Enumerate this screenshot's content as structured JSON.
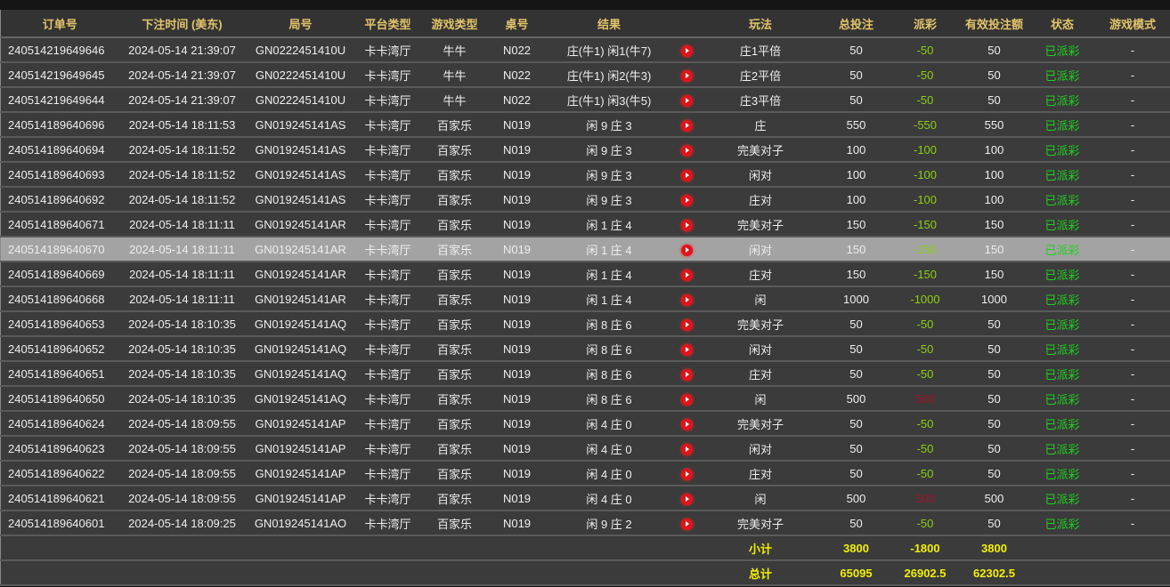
{
  "headers": [
    "订单号",
    "下注时间 (美东)",
    "局号",
    "平台类型",
    "游戏类型",
    "桌号",
    "结果",
    "",
    "玩法",
    "总投注",
    "派彩",
    "有效投注额",
    "状态",
    "游戏模式"
  ],
  "colors": {
    "header_text": "#e2c46a",
    "payout_negative": "#8ccf10",
    "payout_positive": "#a3122c",
    "status": "#1fd01f",
    "footer": "#f2f000",
    "highlight_row": "#a3a3a3"
  },
  "play_icon": "play-video-icon",
  "rows": [
    {
      "id": "240514219649646",
      "time": "2024-05-14 21:39:07",
      "round": "GN0222451410U",
      "platform": "卡卡湾厅",
      "game": "牛牛",
      "table": "N022",
      "result": "庄(牛1) 闲1(牛7)",
      "bet": "庄1平倍",
      "total": "50",
      "payout": "-50",
      "valid": "50",
      "status": "已派彩",
      "mode": "-"
    },
    {
      "id": "240514219649645",
      "time": "2024-05-14 21:39:07",
      "round": "GN0222451410U",
      "platform": "卡卡湾厅",
      "game": "牛牛",
      "table": "N022",
      "result": "庄(牛1) 闲2(牛3)",
      "bet": "庄2平倍",
      "total": "50",
      "payout": "-50",
      "valid": "50",
      "status": "已派彩",
      "mode": "-"
    },
    {
      "id": "240514219649644",
      "time": "2024-05-14 21:39:07",
      "round": "GN0222451410U",
      "platform": "卡卡湾厅",
      "game": "牛牛",
      "table": "N022",
      "result": "庄(牛1) 闲3(牛5)",
      "bet": "庄3平倍",
      "total": "50",
      "payout": "-50",
      "valid": "50",
      "status": "已派彩",
      "mode": "-"
    },
    {
      "id": "240514189640696",
      "time": "2024-05-14 18:11:53",
      "round": "GN019245141AS",
      "platform": "卡卡湾厅",
      "game": "百家乐",
      "table": "N019",
      "result": "闲 9 庄 3",
      "bet": "庄",
      "total": "550",
      "payout": "-550",
      "valid": "550",
      "status": "已派彩",
      "mode": "-"
    },
    {
      "id": "240514189640694",
      "time": "2024-05-14 18:11:52",
      "round": "GN019245141AS",
      "platform": "卡卡湾厅",
      "game": "百家乐",
      "table": "N019",
      "result": "闲 9 庄 3",
      "bet": "完美对子",
      "total": "100",
      "payout": "-100",
      "valid": "100",
      "status": "已派彩",
      "mode": "-"
    },
    {
      "id": "240514189640693",
      "time": "2024-05-14 18:11:52",
      "round": "GN019245141AS",
      "platform": "卡卡湾厅",
      "game": "百家乐",
      "table": "N019",
      "result": "闲 9 庄 3",
      "bet": "闲对",
      "total": "100",
      "payout": "-100",
      "valid": "100",
      "status": "已派彩",
      "mode": "-"
    },
    {
      "id": "240514189640692",
      "time": "2024-05-14 18:11:52",
      "round": "GN019245141AS",
      "platform": "卡卡湾厅",
      "game": "百家乐",
      "table": "N019",
      "result": "闲 9 庄 3",
      "bet": "庄对",
      "total": "100",
      "payout": "-100",
      "valid": "100",
      "status": "已派彩",
      "mode": "-"
    },
    {
      "id": "240514189640671",
      "time": "2024-05-14 18:11:11",
      "round": "GN019245141AR",
      "platform": "卡卡湾厅",
      "game": "百家乐",
      "table": "N019",
      "result": "闲 1 庄 4",
      "bet": "完美对子",
      "total": "150",
      "payout": "-150",
      "valid": "150",
      "status": "已派彩",
      "mode": "-"
    },
    {
      "id": "240514189640670",
      "time": "2024-05-14 18:11:11",
      "round": "GN019245141AR",
      "platform": "卡卡湾厅",
      "game": "百家乐",
      "table": "N019",
      "result": "闲 1 庄 4",
      "bet": "闲对",
      "total": "150",
      "payout": "-150",
      "valid": "150",
      "status": "已派彩",
      "mode": "-",
      "highlighted": true
    },
    {
      "id": "240514189640669",
      "time": "2024-05-14 18:11:11",
      "round": "GN019245141AR",
      "platform": "卡卡湾厅",
      "game": "百家乐",
      "table": "N019",
      "result": "闲 1 庄 4",
      "bet": "庄对",
      "total": "150",
      "payout": "-150",
      "valid": "150",
      "status": "已派彩",
      "mode": "-"
    },
    {
      "id": "240514189640668",
      "time": "2024-05-14 18:11:11",
      "round": "GN019245141AR",
      "platform": "卡卡湾厅",
      "game": "百家乐",
      "table": "N019",
      "result": "闲 1 庄 4",
      "bet": "闲",
      "total": "1000",
      "payout": "-1000",
      "valid": "1000",
      "status": "已派彩",
      "mode": "-"
    },
    {
      "id": "240514189640653",
      "time": "2024-05-14 18:10:35",
      "round": "GN019245141AQ",
      "platform": "卡卡湾厅",
      "game": "百家乐",
      "table": "N019",
      "result": "闲 8 庄 6",
      "bet": "完美对子",
      "total": "50",
      "payout": "-50",
      "valid": "50",
      "status": "已派彩",
      "mode": "-"
    },
    {
      "id": "240514189640652",
      "time": "2024-05-14 18:10:35",
      "round": "GN019245141AQ",
      "platform": "卡卡湾厅",
      "game": "百家乐",
      "table": "N019",
      "result": "闲 8 庄 6",
      "bet": "闲对",
      "total": "50",
      "payout": "-50",
      "valid": "50",
      "status": "已派彩",
      "mode": "-"
    },
    {
      "id": "240514189640651",
      "time": "2024-05-14 18:10:35",
      "round": "GN019245141AQ",
      "platform": "卡卡湾厅",
      "game": "百家乐",
      "table": "N019",
      "result": "闲 8 庄 6",
      "bet": "庄对",
      "total": "50",
      "payout": "-50",
      "valid": "50",
      "status": "已派彩",
      "mode": "-"
    },
    {
      "id": "240514189640650",
      "time": "2024-05-14 18:10:35",
      "round": "GN019245141AQ",
      "platform": "卡卡湾厅",
      "game": "百家乐",
      "table": "N019",
      "result": "闲 8 庄 6",
      "bet": "闲",
      "total": "500",
      "payout": "500",
      "valid": "50",
      "status": "已派彩",
      "mode": "-"
    },
    {
      "id": "240514189640624",
      "time": "2024-05-14 18:09:55",
      "round": "GN019245141AP",
      "platform": "卡卡湾厅",
      "game": "百家乐",
      "table": "N019",
      "result": "闲 4 庄 0",
      "bet": "完美对子",
      "total": "50",
      "payout": "-50",
      "valid": "50",
      "status": "已派彩",
      "mode": "-"
    },
    {
      "id": "240514189640623",
      "time": "2024-05-14 18:09:55",
      "round": "GN019245141AP",
      "platform": "卡卡湾厅",
      "game": "百家乐",
      "table": "N019",
      "result": "闲 4 庄 0",
      "bet": "闲对",
      "total": "50",
      "payout": "-50",
      "valid": "50",
      "status": "已派彩",
      "mode": "-"
    },
    {
      "id": "240514189640622",
      "time": "2024-05-14 18:09:55",
      "round": "GN019245141AP",
      "platform": "卡卡湾厅",
      "game": "百家乐",
      "table": "N019",
      "result": "闲 4 庄 0",
      "bet": "庄对",
      "total": "50",
      "payout": "-50",
      "valid": "50",
      "status": "已派彩",
      "mode": "-"
    },
    {
      "id": "240514189640621",
      "time": "2024-05-14 18:09:55",
      "round": "GN019245141AP",
      "platform": "卡卡湾厅",
      "game": "百家乐",
      "table": "N019",
      "result": "闲 4 庄 0",
      "bet": "闲",
      "total": "500",
      "payout": "500",
      "valid": "500",
      "status": "已派彩",
      "mode": "-"
    },
    {
      "id": "240514189640601",
      "time": "2024-05-14 18:09:25",
      "round": "GN019245141AO",
      "platform": "卡卡湾厅",
      "game": "百家乐",
      "table": "N019",
      "result": "闲 9 庄 2",
      "bet": "完美对子",
      "total": "50",
      "payout": "-50",
      "valid": "50",
      "status": "已派彩",
      "mode": "-"
    }
  ],
  "subtotal": {
    "label": "小计",
    "total": "3800",
    "payout": "-1800",
    "valid": "3800"
  },
  "grandtotal": {
    "label": "总计",
    "total": "65095",
    "payout": "26902.5",
    "valid": "62302.5"
  }
}
